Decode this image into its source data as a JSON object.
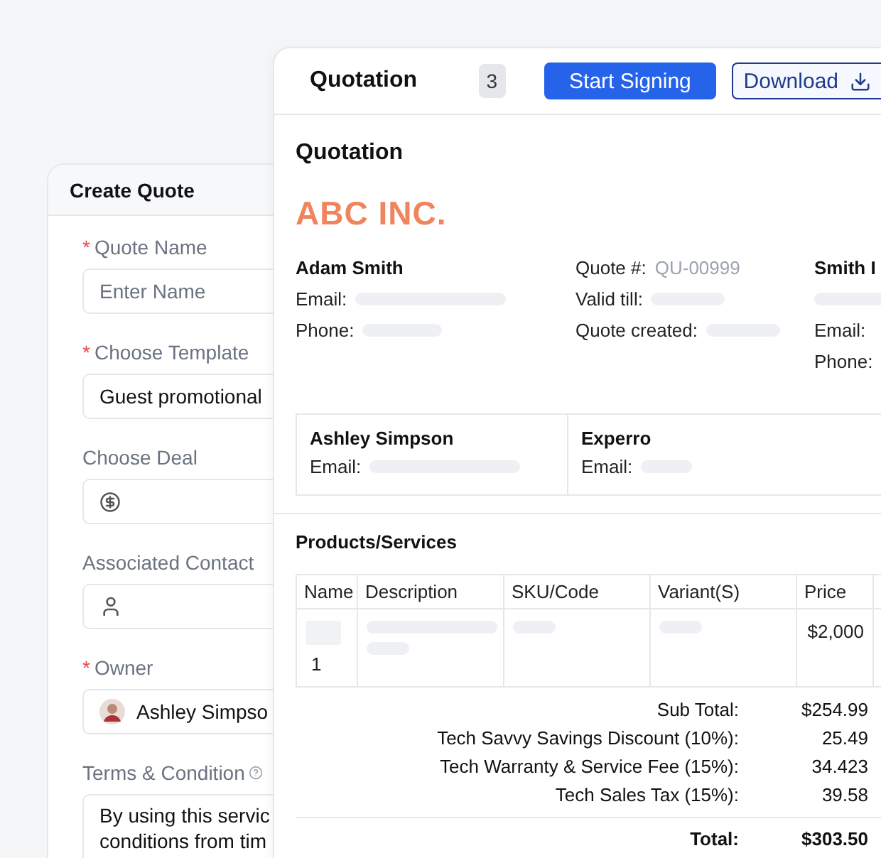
{
  "create_quote": {
    "title": "Create Quote",
    "required_mark": "*",
    "fields": [
      {
        "label": "Quote Name",
        "required": true,
        "kind": "text",
        "placeholder": "Enter Name"
      },
      {
        "label": "Choose Template",
        "required": true,
        "kind": "text",
        "value": "Guest promotional"
      },
      {
        "label": "Choose Deal",
        "required": false,
        "kind": "deal"
      },
      {
        "label": "Associated Contact",
        "required": false,
        "kind": "contact"
      },
      {
        "label": "Owner",
        "required": true,
        "kind": "owner",
        "value": "Ashley Simpso"
      },
      {
        "label": "Terms & Condition",
        "required": false,
        "help": true,
        "kind": "textarea",
        "lines": [
          "By using this servic",
          "conditions from tim"
        ]
      }
    ]
  },
  "quotation": {
    "title": "Quotation",
    "count": "3",
    "actions": [
      {
        "label": "Start Signing",
        "kind": "primary"
      },
      {
        "label": "Download",
        "kind": "secondary"
      }
    ],
    "document": {
      "heading": "Quotation",
      "company": "ABC INC.",
      "from": {
        "name": "Adam Smith",
        "fields": [
          "Email:",
          "Phone:"
        ]
      },
      "meta": [
        {
          "label": "Quote #:",
          "value": "QU-00999"
        },
        {
          "label": "Valid till:"
        },
        {
          "label": "Quote created:"
        }
      ],
      "to": {
        "name": "Smith I",
        "fields": [
          "Email:",
          "Phone:"
        ]
      },
      "contacts": [
        {
          "name": "Ashley Simpson",
          "label": "Email:"
        },
        {
          "name": "Experro",
          "label": "Email:"
        }
      ],
      "products": {
        "title": "Products/Services",
        "columns": [
          "Name",
          "Description",
          "SKU/Code",
          "Variant(S)",
          "Price"
        ],
        "rows": [
          {
            "name": "1",
            "price": "$2,000"
          }
        ]
      },
      "totals": [
        {
          "label": "Sub Total:",
          "value": "$254.99"
        },
        {
          "label": "Tech Savvy Savings Discount (10%):",
          "value": "25.49"
        },
        {
          "label": "Tech Warranty & Service Fee (15%):",
          "value": "34.423"
        },
        {
          "label": "Tech Sales Tax (15%):",
          "value": "39.58"
        }
      ],
      "total": {
        "label": "Total:",
        "value": "$303.50"
      }
    }
  }
}
